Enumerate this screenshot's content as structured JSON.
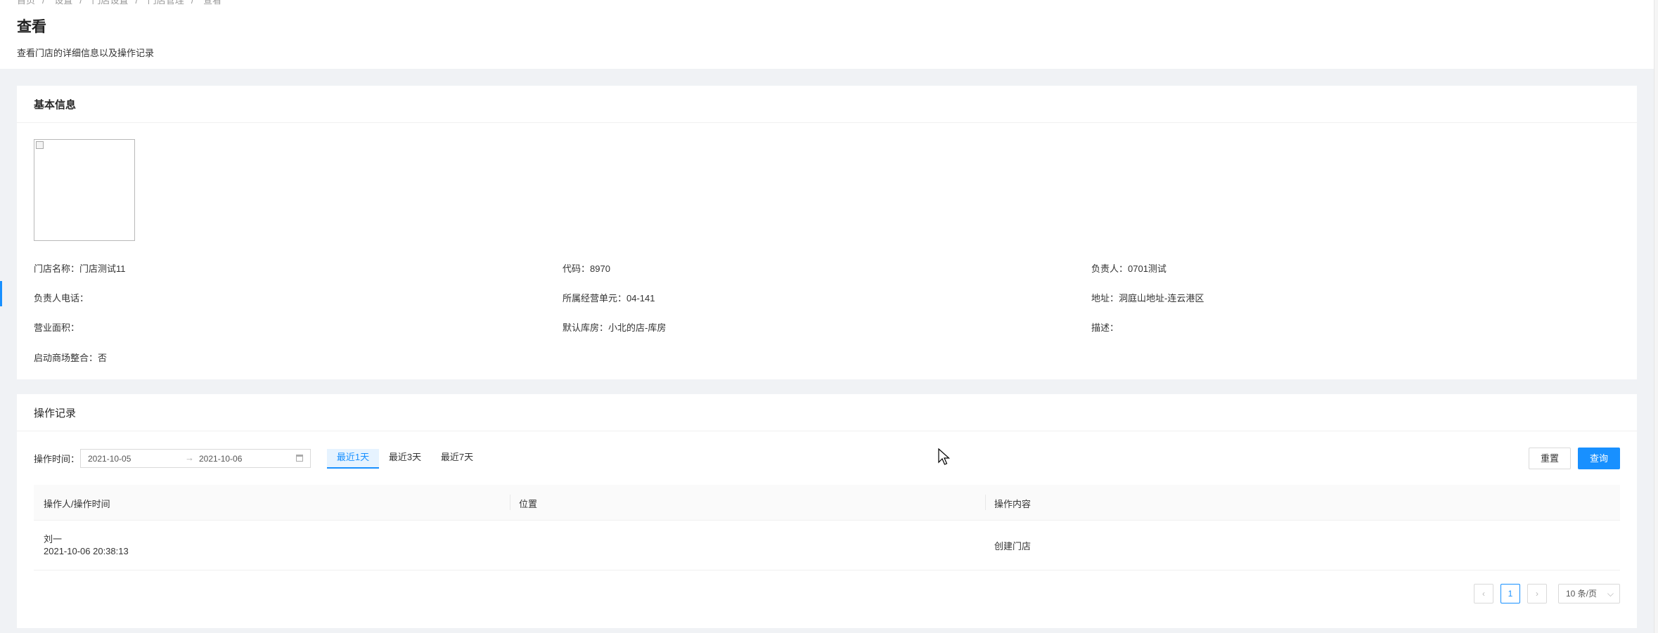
{
  "breadcrumb": [
    "首页",
    "设置",
    "门店设置",
    "门店管理",
    "查看"
  ],
  "header": {
    "title": "查看",
    "description": "查看门店的详细信息以及操作记录"
  },
  "basic_info": {
    "title": "基本信息",
    "fields": {
      "store_name": "门店名称：门店测试11",
      "code": "代码：8970",
      "manager": "负责人：0701测试",
      "manager_phone": "负责人电话：",
      "unit": "所属经营单元：04-141",
      "address": "地址：洞庭山地址-连云港区",
      "area": "营业面积：",
      "warehouse": "默认库房：小北的店-库房",
      "description": "描述：",
      "mall_integration": "启动商场整合：否"
    }
  },
  "records": {
    "title": "操作记录",
    "filter_label": "操作时间：",
    "date_start": "2021-10-05",
    "date_arrow": "→",
    "date_end": "2021-10-06",
    "quick_tabs": [
      "最近1天",
      "最近3天",
      "最近7天"
    ],
    "reset_label": "重置",
    "query_label": "查询",
    "columns": [
      "操作人/操作时间",
      "位置",
      "操作内容"
    ],
    "rows": [
      {
        "operator": "刘一",
        "time": "2021-10-06 20:38:13",
        "location": "",
        "content": "创建门店"
      }
    ],
    "pagination": {
      "prev": "‹",
      "current_page": "1",
      "next": "›",
      "page_size": "10 条/页",
      "chevron": "⌵"
    }
  },
  "colors": {
    "accent": "#1890ff",
    "page_bg": "#f0f2f5"
  }
}
